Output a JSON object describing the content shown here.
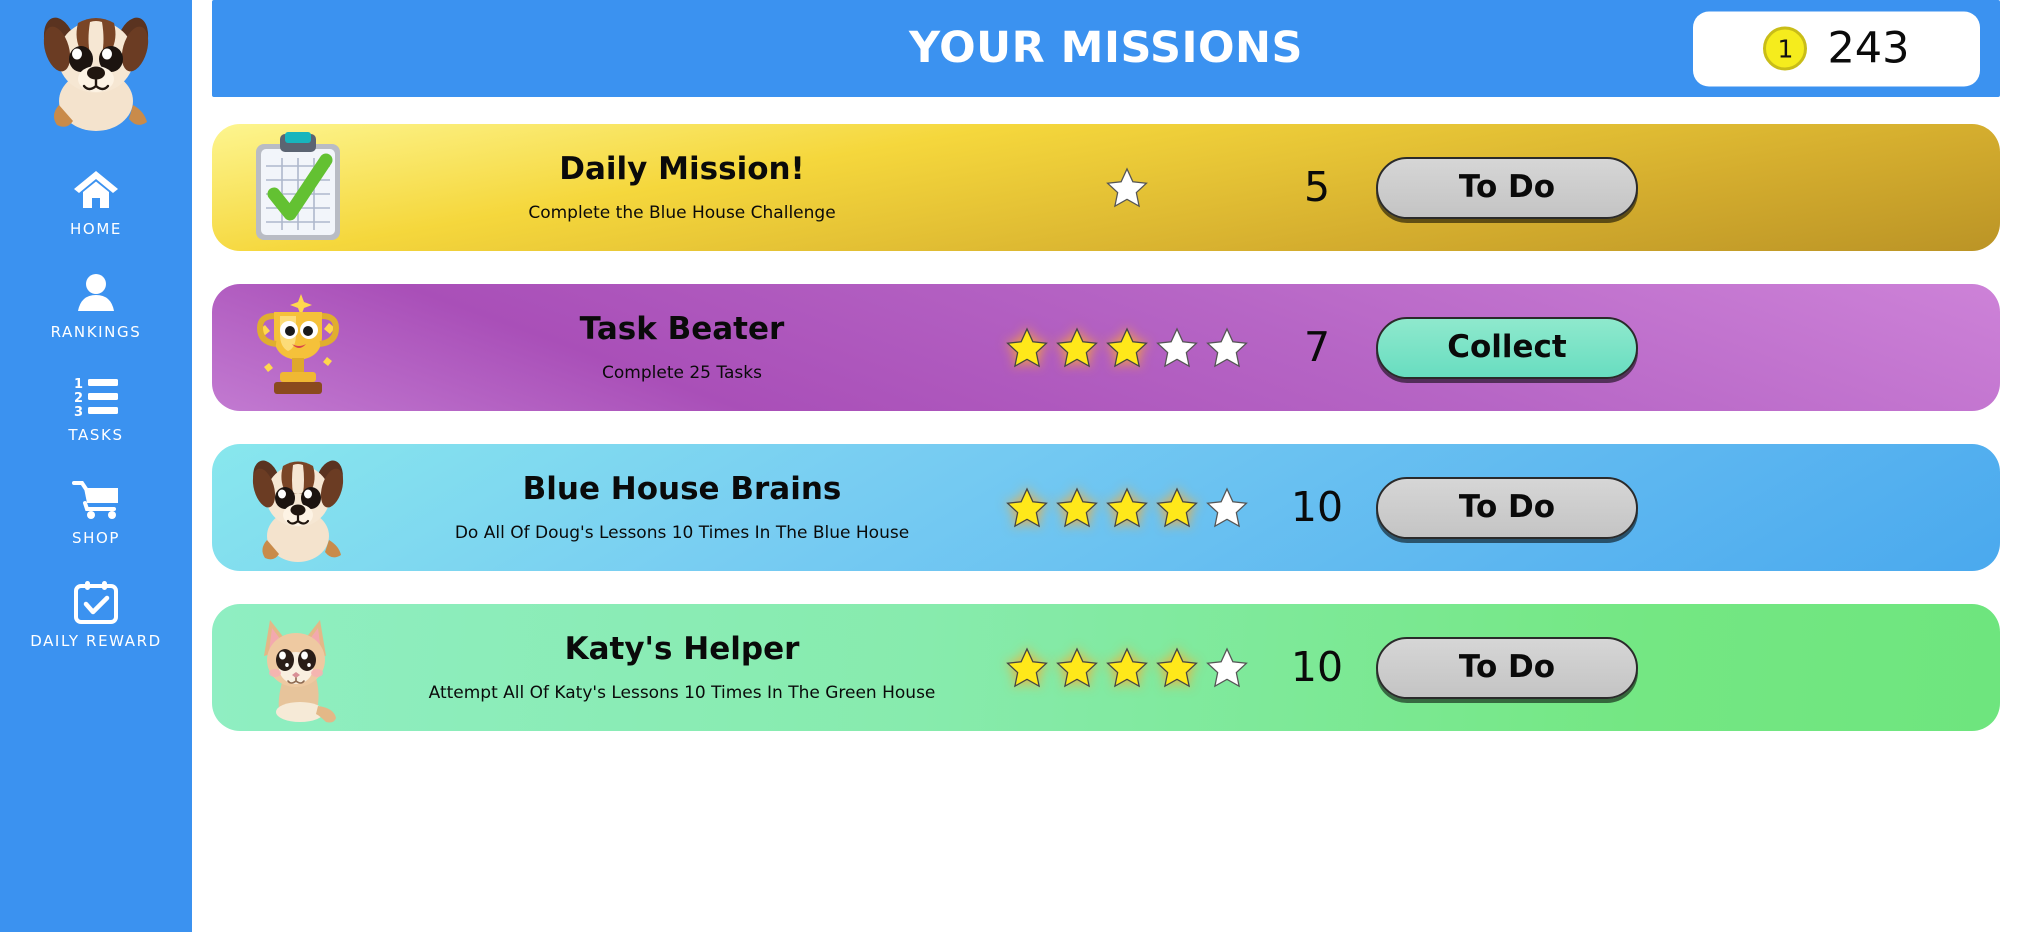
{
  "sidebar": {
    "avatar_icon": "puppy-avatar",
    "items": [
      {
        "label": "HOME",
        "icon": "home-icon"
      },
      {
        "label": "RANKINGS",
        "icon": "person-icon"
      },
      {
        "label": "TASKS",
        "icon": "numbered-list-icon"
      },
      {
        "label": "SHOP",
        "icon": "shopping-cart-icon"
      },
      {
        "label": "DAILY REWARD",
        "icon": "calendar-check-icon"
      }
    ]
  },
  "header": {
    "title": "YOUR MISSIONS",
    "coin": {
      "icon": "coin-icon",
      "coin_label": "1",
      "amount": "243"
    }
  },
  "missions": [
    {
      "title": "Daily Mission!",
      "subtitle": "Complete the Blue House Challenge",
      "icon": "clipboard-check-icon",
      "stars_total": 1,
      "stars_filled": 0,
      "reward": "5",
      "action_label": "To Do",
      "action_state": "todo",
      "theme": "gold"
    },
    {
      "title": "Task Beater",
      "subtitle": "Complete 25 Tasks",
      "icon": "trophy-icon",
      "stars_total": 5,
      "stars_filled": 3,
      "reward": "7",
      "action_label": "Collect",
      "action_state": "collect",
      "theme": "purple"
    },
    {
      "title": "Blue House Brains",
      "subtitle": "Do All Of Doug's Lessons 10 Times In The Blue House",
      "icon": "dog-icon",
      "stars_total": 5,
      "stars_filled": 4,
      "reward": "10",
      "action_label": "To Do",
      "action_state": "todo",
      "theme": "blue"
    },
    {
      "title": "Katy's Helper",
      "subtitle": "Attempt All Of Katy's Lessons 10 Times In The Green House",
      "icon": "cat-icon",
      "stars_total": 5,
      "stars_filled": 4,
      "reward": "10",
      "action_label": "To Do",
      "action_state": "todo",
      "theme": "green"
    }
  ],
  "colors": {
    "brand_blue": "#3b92f0",
    "coin_yellow": "#f5ec1d",
    "star_filled": "#ffe81a",
    "star_empty": "#ffffff",
    "collect_green": "#8fe9cd",
    "todo_grey": "#d0d0d0",
    "gold_card": "#f5d73c",
    "purple_card": "#b665c5",
    "blue_card": "#5cb6f0",
    "green_card": "#7ae87e"
  }
}
